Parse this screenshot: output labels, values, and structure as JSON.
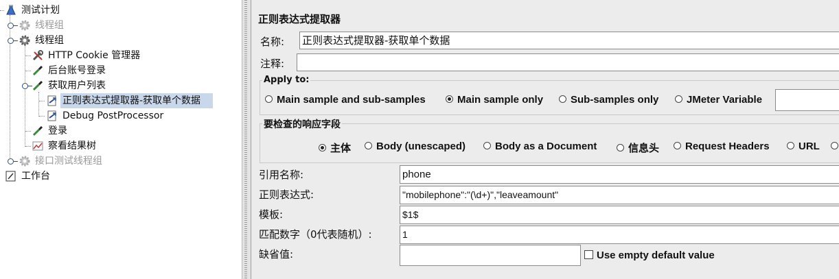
{
  "tree": {
    "items": [
      {
        "label": "测试计划",
        "icon": "test-plan-icon"
      },
      {
        "label": "线程组",
        "icon": "thread-group-gear-icon"
      },
      {
        "label": "线程组",
        "icon": "thread-group-gear-icon"
      },
      {
        "label": "HTTP Cookie 管理器",
        "icon": "wrench-icon"
      },
      {
        "label": "后台账号登录",
        "icon": "pipette-icon"
      },
      {
        "label": "获取用户列表",
        "icon": "pipette-icon"
      },
      {
        "label": "正则表达式提取器-获取单个数据",
        "icon": "post-processor-icon"
      },
      {
        "label": "Debug PostProcessor",
        "icon": "post-processor-icon"
      },
      {
        "label": "登录",
        "icon": "pipette-icon"
      },
      {
        "label": "察看结果树",
        "icon": "chart-icon"
      },
      {
        "label": "接口测试线程组",
        "icon": "thread-group-gear-icon"
      },
      {
        "label": "工作台",
        "icon": "workbench-icon"
      }
    ]
  },
  "panel": {
    "title": "正则表达式提取器",
    "name_label": "名称:",
    "name_value": "正则表达式提取器-获取单个数据",
    "comment_label": "注释:",
    "comment_value": "",
    "apply_to": {
      "title": "Apply to:",
      "options": [
        "Main sample and sub-samples",
        "Main sample only",
        "Sub-samples only",
        "JMeter Variable"
      ],
      "selected": "Main sample only",
      "variable_value": ""
    },
    "response_field": {
      "title": "要检查的响应字段",
      "options": [
        "主体",
        "Body (unescaped)",
        "Body as a Document",
        "信息头",
        "Request Headers",
        "URL"
      ],
      "selected": "主体"
    },
    "ref_name_label": "引用名称:",
    "ref_name_value": "phone",
    "regex_label": "正则表达式:",
    "regex_value": "\"mobilephone\":\"(\\d+)\",\"leaveamount\"",
    "template_label": "模板:",
    "template_value": "$1$",
    "match_no_label": "匹配数字（0代表随机）:",
    "match_no_value": "1",
    "default_label": "缺省值:",
    "default_value": "",
    "use_empty_label": "Use empty default value",
    "use_empty_checked": false
  },
  "colors": {
    "selected_bg": "#c9d7ea",
    "disabled_text": "#9a9a9a"
  }
}
